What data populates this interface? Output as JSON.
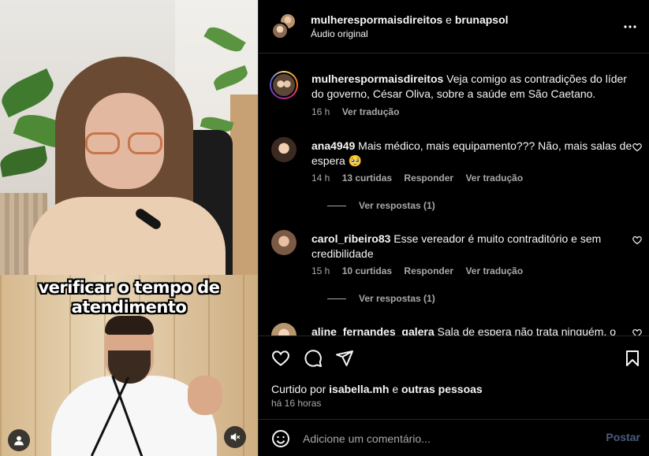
{
  "video": {
    "caption": "verificar o tempo de atendimento",
    "profile_icon": "person-icon",
    "mute_icon": "speaker-muted-icon"
  },
  "header": {
    "user1": "mulherespormaisdireitos",
    "connector": "e",
    "user2": "brunapsol",
    "audio": "Áudio original",
    "more_icon": "more-horizontal-icon"
  },
  "caption_post": {
    "user": "mulherespormaisdireitos",
    "text": "Veja comigo as contradições do líder do governo, César Oliva, sobre a saúde em São Caetano.",
    "time": "16 h",
    "translate": "Ver tradução"
  },
  "comments": [
    {
      "user": "ana4949",
      "text": "Mais médico, mais equipamento??? Não, mais salas de espera 🥺",
      "time": "14 h",
      "likes": "13 curtidas",
      "reply": "Responder",
      "translate": "Ver tradução",
      "view_replies": "Ver respostas (1)"
    },
    {
      "user": "carol_ribeiro83",
      "text": "Esse vereador é muito contraditório e sem credibilidade",
      "time": "15 h",
      "likes": "10 curtidas",
      "reply": "Responder",
      "translate": "Ver tradução",
      "view_replies": "Ver respostas (1)"
    },
    {
      "user": "aline_fernandes_galera",
      "text": "Sala de espera não trata ninguém, o"
    }
  ],
  "likes": {
    "prefix": "Curtido por",
    "user": "isabella.mh",
    "connector": "e",
    "others": "outras pessoas"
  },
  "posted": "há 16 horas",
  "composer": {
    "placeholder": "Adicione um comentário...",
    "post_label": "Postar"
  },
  "colors": {
    "background": "#000000",
    "muted_text": "#a8a8a8",
    "post_button": "#4a5d7e",
    "story_ring": "#d6249f"
  }
}
